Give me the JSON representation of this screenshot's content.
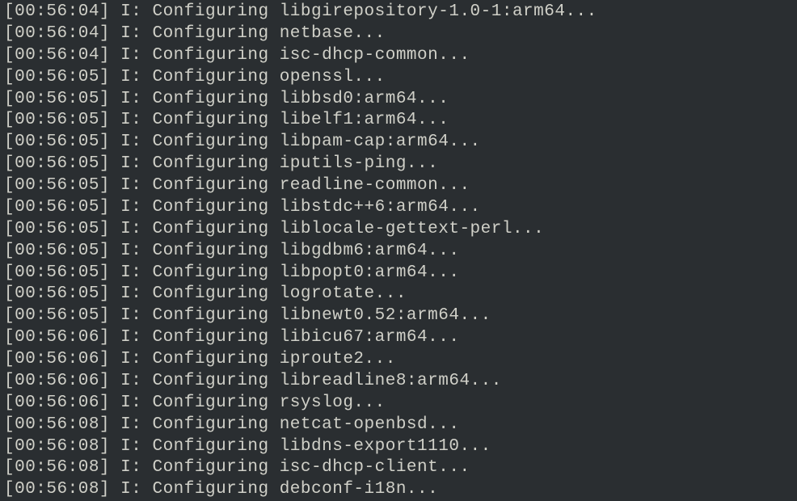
{
  "log_lines": [
    {
      "timestamp": "[00:56:04]",
      "level": "I:",
      "action": "Configuring",
      "package": "libgirepository-1.0-1:arm64..."
    },
    {
      "timestamp": "[00:56:04]",
      "level": "I:",
      "action": "Configuring",
      "package": "netbase..."
    },
    {
      "timestamp": "[00:56:04]",
      "level": "I:",
      "action": "Configuring",
      "package": "isc-dhcp-common..."
    },
    {
      "timestamp": "[00:56:05]",
      "level": "I:",
      "action": "Configuring",
      "package": "openssl..."
    },
    {
      "timestamp": "[00:56:05]",
      "level": "I:",
      "action": "Configuring",
      "package": "libbsd0:arm64..."
    },
    {
      "timestamp": "[00:56:05]",
      "level": "I:",
      "action": "Configuring",
      "package": "libelf1:arm64..."
    },
    {
      "timestamp": "[00:56:05]",
      "level": "I:",
      "action": "Configuring",
      "package": "libpam-cap:arm64..."
    },
    {
      "timestamp": "[00:56:05]",
      "level": "I:",
      "action": "Configuring",
      "package": "iputils-ping..."
    },
    {
      "timestamp": "[00:56:05]",
      "level": "I:",
      "action": "Configuring",
      "package": "readline-common..."
    },
    {
      "timestamp": "[00:56:05]",
      "level": "I:",
      "action": "Configuring",
      "package": "libstdc++6:arm64..."
    },
    {
      "timestamp": "[00:56:05]",
      "level": "I:",
      "action": "Configuring",
      "package": "liblocale-gettext-perl..."
    },
    {
      "timestamp": "[00:56:05]",
      "level": "I:",
      "action": "Configuring",
      "package": "libgdbm6:arm64..."
    },
    {
      "timestamp": "[00:56:05]",
      "level": "I:",
      "action": "Configuring",
      "package": "libpopt0:arm64..."
    },
    {
      "timestamp": "[00:56:05]",
      "level": "I:",
      "action": "Configuring",
      "package": "logrotate..."
    },
    {
      "timestamp": "[00:56:05]",
      "level": "I:",
      "action": "Configuring",
      "package": "libnewt0.52:arm64..."
    },
    {
      "timestamp": "[00:56:06]",
      "level": "I:",
      "action": "Configuring",
      "package": "libicu67:arm64..."
    },
    {
      "timestamp": "[00:56:06]",
      "level": "I:",
      "action": "Configuring",
      "package": "iproute2..."
    },
    {
      "timestamp": "[00:56:06]",
      "level": "I:",
      "action": "Configuring",
      "package": "libreadline8:arm64..."
    },
    {
      "timestamp": "[00:56:06]",
      "level": "I:",
      "action": "Configuring",
      "package": "rsyslog..."
    },
    {
      "timestamp": "[00:56:08]",
      "level": "I:",
      "action": "Configuring",
      "package": "netcat-openbsd..."
    },
    {
      "timestamp": "[00:56:08]",
      "level": "I:",
      "action": "Configuring",
      "package": "libdns-export1110..."
    },
    {
      "timestamp": "[00:56:08]",
      "level": "I:",
      "action": "Configuring",
      "package": "isc-dhcp-client..."
    },
    {
      "timestamp": "[00:56:08]",
      "level": "I:",
      "action": "Configuring",
      "package": "debconf-i18n..."
    }
  ]
}
